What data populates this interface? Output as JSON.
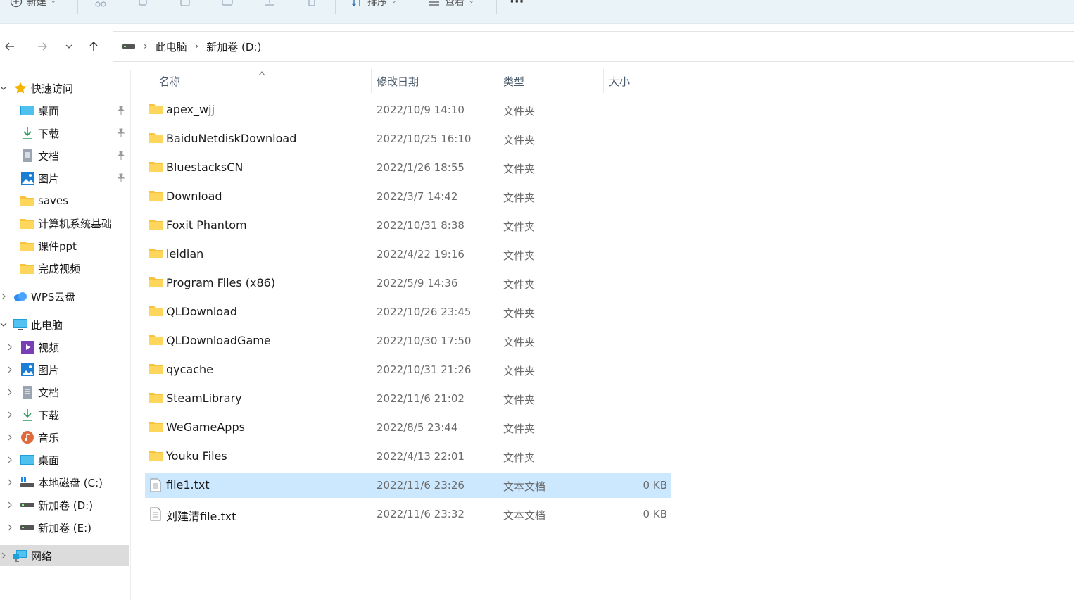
{
  "toolbar": {
    "new_label": "新建",
    "sort_label": "排序",
    "view_label": "查看",
    "more_label": "···"
  },
  "address": {
    "crumbs": [
      "此电脑",
      "新加卷 (D:)"
    ]
  },
  "sidebar": {
    "quick_access": "快速访问",
    "pinned": [
      {
        "label": "桌面",
        "icon": "desktop-icon"
      },
      {
        "label": "下载",
        "icon": "download-icon"
      },
      {
        "label": "文档",
        "icon": "document-icon"
      },
      {
        "label": "图片",
        "icon": "pictures-icon"
      }
    ],
    "recent": [
      "saves",
      "计算机系统基础",
      "课件ppt",
      "完成视频"
    ],
    "wps_cloud": "WPS云盘",
    "this_pc": "此电脑",
    "pc_items": [
      {
        "label": "视频",
        "icon": "videos-icon"
      },
      {
        "label": "图片",
        "icon": "pictures-icon"
      },
      {
        "label": "文档",
        "icon": "document-icon"
      },
      {
        "label": "下载",
        "icon": "download-icon"
      },
      {
        "label": "音乐",
        "icon": "music-icon"
      },
      {
        "label": "桌面",
        "icon": "desktop-icon"
      },
      {
        "label": "本地磁盘 (C:)",
        "icon": "system-drive-icon"
      },
      {
        "label": "新加卷 (D:)",
        "icon": "drive-icon"
      },
      {
        "label": "新加卷 (E:)",
        "icon": "drive-icon"
      }
    ],
    "network": "网络"
  },
  "columns": {
    "name": "名称",
    "modified": "修改日期",
    "type": "类型",
    "size": "大小"
  },
  "files": [
    {
      "name": "apex_wjj",
      "date": "2022/10/9 14:10",
      "type": "文件夹",
      "size": "",
      "kind": "folder"
    },
    {
      "name": "BaiduNetdiskDownload",
      "date": "2022/10/25 16:10",
      "type": "文件夹",
      "size": "",
      "kind": "folder"
    },
    {
      "name": "BluestacksCN",
      "date": "2022/1/26 18:55",
      "type": "文件夹",
      "size": "",
      "kind": "folder"
    },
    {
      "name": "Download",
      "date": "2022/3/7 14:42",
      "type": "文件夹",
      "size": "",
      "kind": "folder"
    },
    {
      "name": "Foxit Phantom",
      "date": "2022/10/31 8:38",
      "type": "文件夹",
      "size": "",
      "kind": "folder"
    },
    {
      "name": "leidian",
      "date": "2022/4/22 19:16",
      "type": "文件夹",
      "size": "",
      "kind": "folder"
    },
    {
      "name": "Program Files (x86)",
      "date": "2022/5/9 14:36",
      "type": "文件夹",
      "size": "",
      "kind": "folder"
    },
    {
      "name": "QLDownload",
      "date": "2022/10/26 23:45",
      "type": "文件夹",
      "size": "",
      "kind": "folder"
    },
    {
      "name": "QLDownloadGame",
      "date": "2022/10/30 17:50",
      "type": "文件夹",
      "size": "",
      "kind": "folder"
    },
    {
      "name": "qycache",
      "date": "2022/10/31 21:26",
      "type": "文件夹",
      "size": "",
      "kind": "folder"
    },
    {
      "name": "SteamLibrary",
      "date": "2022/11/6 21:02",
      "type": "文件夹",
      "size": "",
      "kind": "folder"
    },
    {
      "name": "WeGameApps",
      "date": "2022/8/5 23:44",
      "type": "文件夹",
      "size": "",
      "kind": "folder"
    },
    {
      "name": "Youku Files",
      "date": "2022/4/13 22:01",
      "type": "文件夹",
      "size": "",
      "kind": "folder"
    },
    {
      "name": "file1.txt",
      "date": "2022/11/6 23:26",
      "type": "文本文档",
      "size": "0 KB",
      "kind": "text",
      "selected": true
    },
    {
      "name": "刘建清file.txt",
      "date": "2022/11/6 23:32",
      "type": "文本文档",
      "size": "0 KB",
      "kind": "text"
    }
  ],
  "colors": {
    "command_bar_bg": "#e9f3f8",
    "selection_bg": "#cce8ff",
    "sidebar_selected_bg": "#dcdcdc",
    "folder_yellow": "#f8c23a"
  }
}
